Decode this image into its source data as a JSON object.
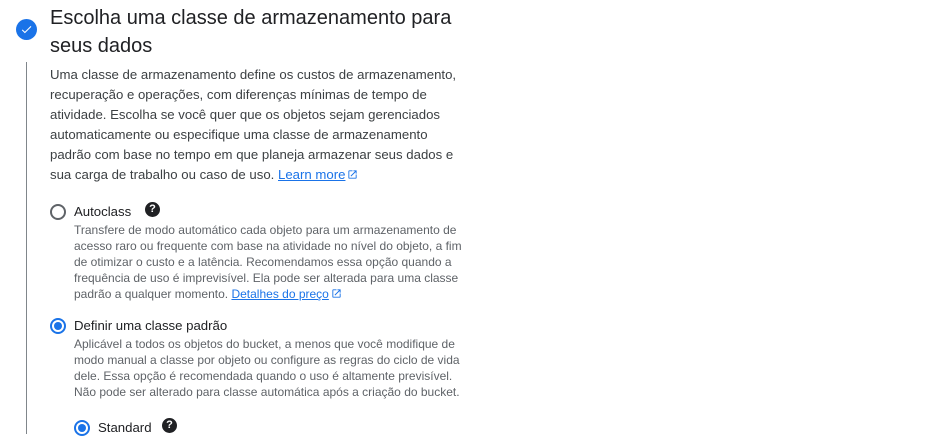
{
  "step": {
    "title": "Escolha uma classe de armazenamento para seus dados",
    "description": "Uma classe de armazenamento define os custos de armazenamento, recuperação e operações, com diferenças mínimas de tempo de atividade. Escolha se você quer que os objetos sejam gerenciados automaticamente ou especifique uma classe de armazenamento padrão com base no tempo em que planeja armazenar seus dados e sua carga de trabalho ou caso de uso.",
    "learn_more": "Learn more"
  },
  "options": {
    "autoclass": {
      "label": "Autoclass",
      "selected": false,
      "description": "Transfere de modo automático cada objeto para um armazenamento de acesso raro ou frequente com base na atividade no nível do objeto, a fim de otimizar o custo e a latência. Recomendamos essa opção quando a frequência de uso é imprevisível. Ela pode ser alterada para uma classe padrão a qualquer momento.",
      "pricing_link": "Detalhes do preço"
    },
    "default_class": {
      "label": "Definir uma classe padrão",
      "selected": true,
      "description": "Aplicável a todos os objetos do bucket, a menos que você modifique de modo manual a classe por objeto ou configure as regras do ciclo de vida dele. Essa opção é recomendada quando o uso é altamente previsível. Não pode ser alterado para classe automática após a criação do bucket."
    },
    "standard": {
      "label": "Standard",
      "selected": true
    }
  },
  "colors": {
    "accent": "#1a73e8",
    "text": "#202124",
    "secondary_text": "#5f6368"
  },
  "icons": {
    "step_status": "check-icon",
    "help": "question-mark-icon",
    "external_link": "external-link-icon"
  }
}
